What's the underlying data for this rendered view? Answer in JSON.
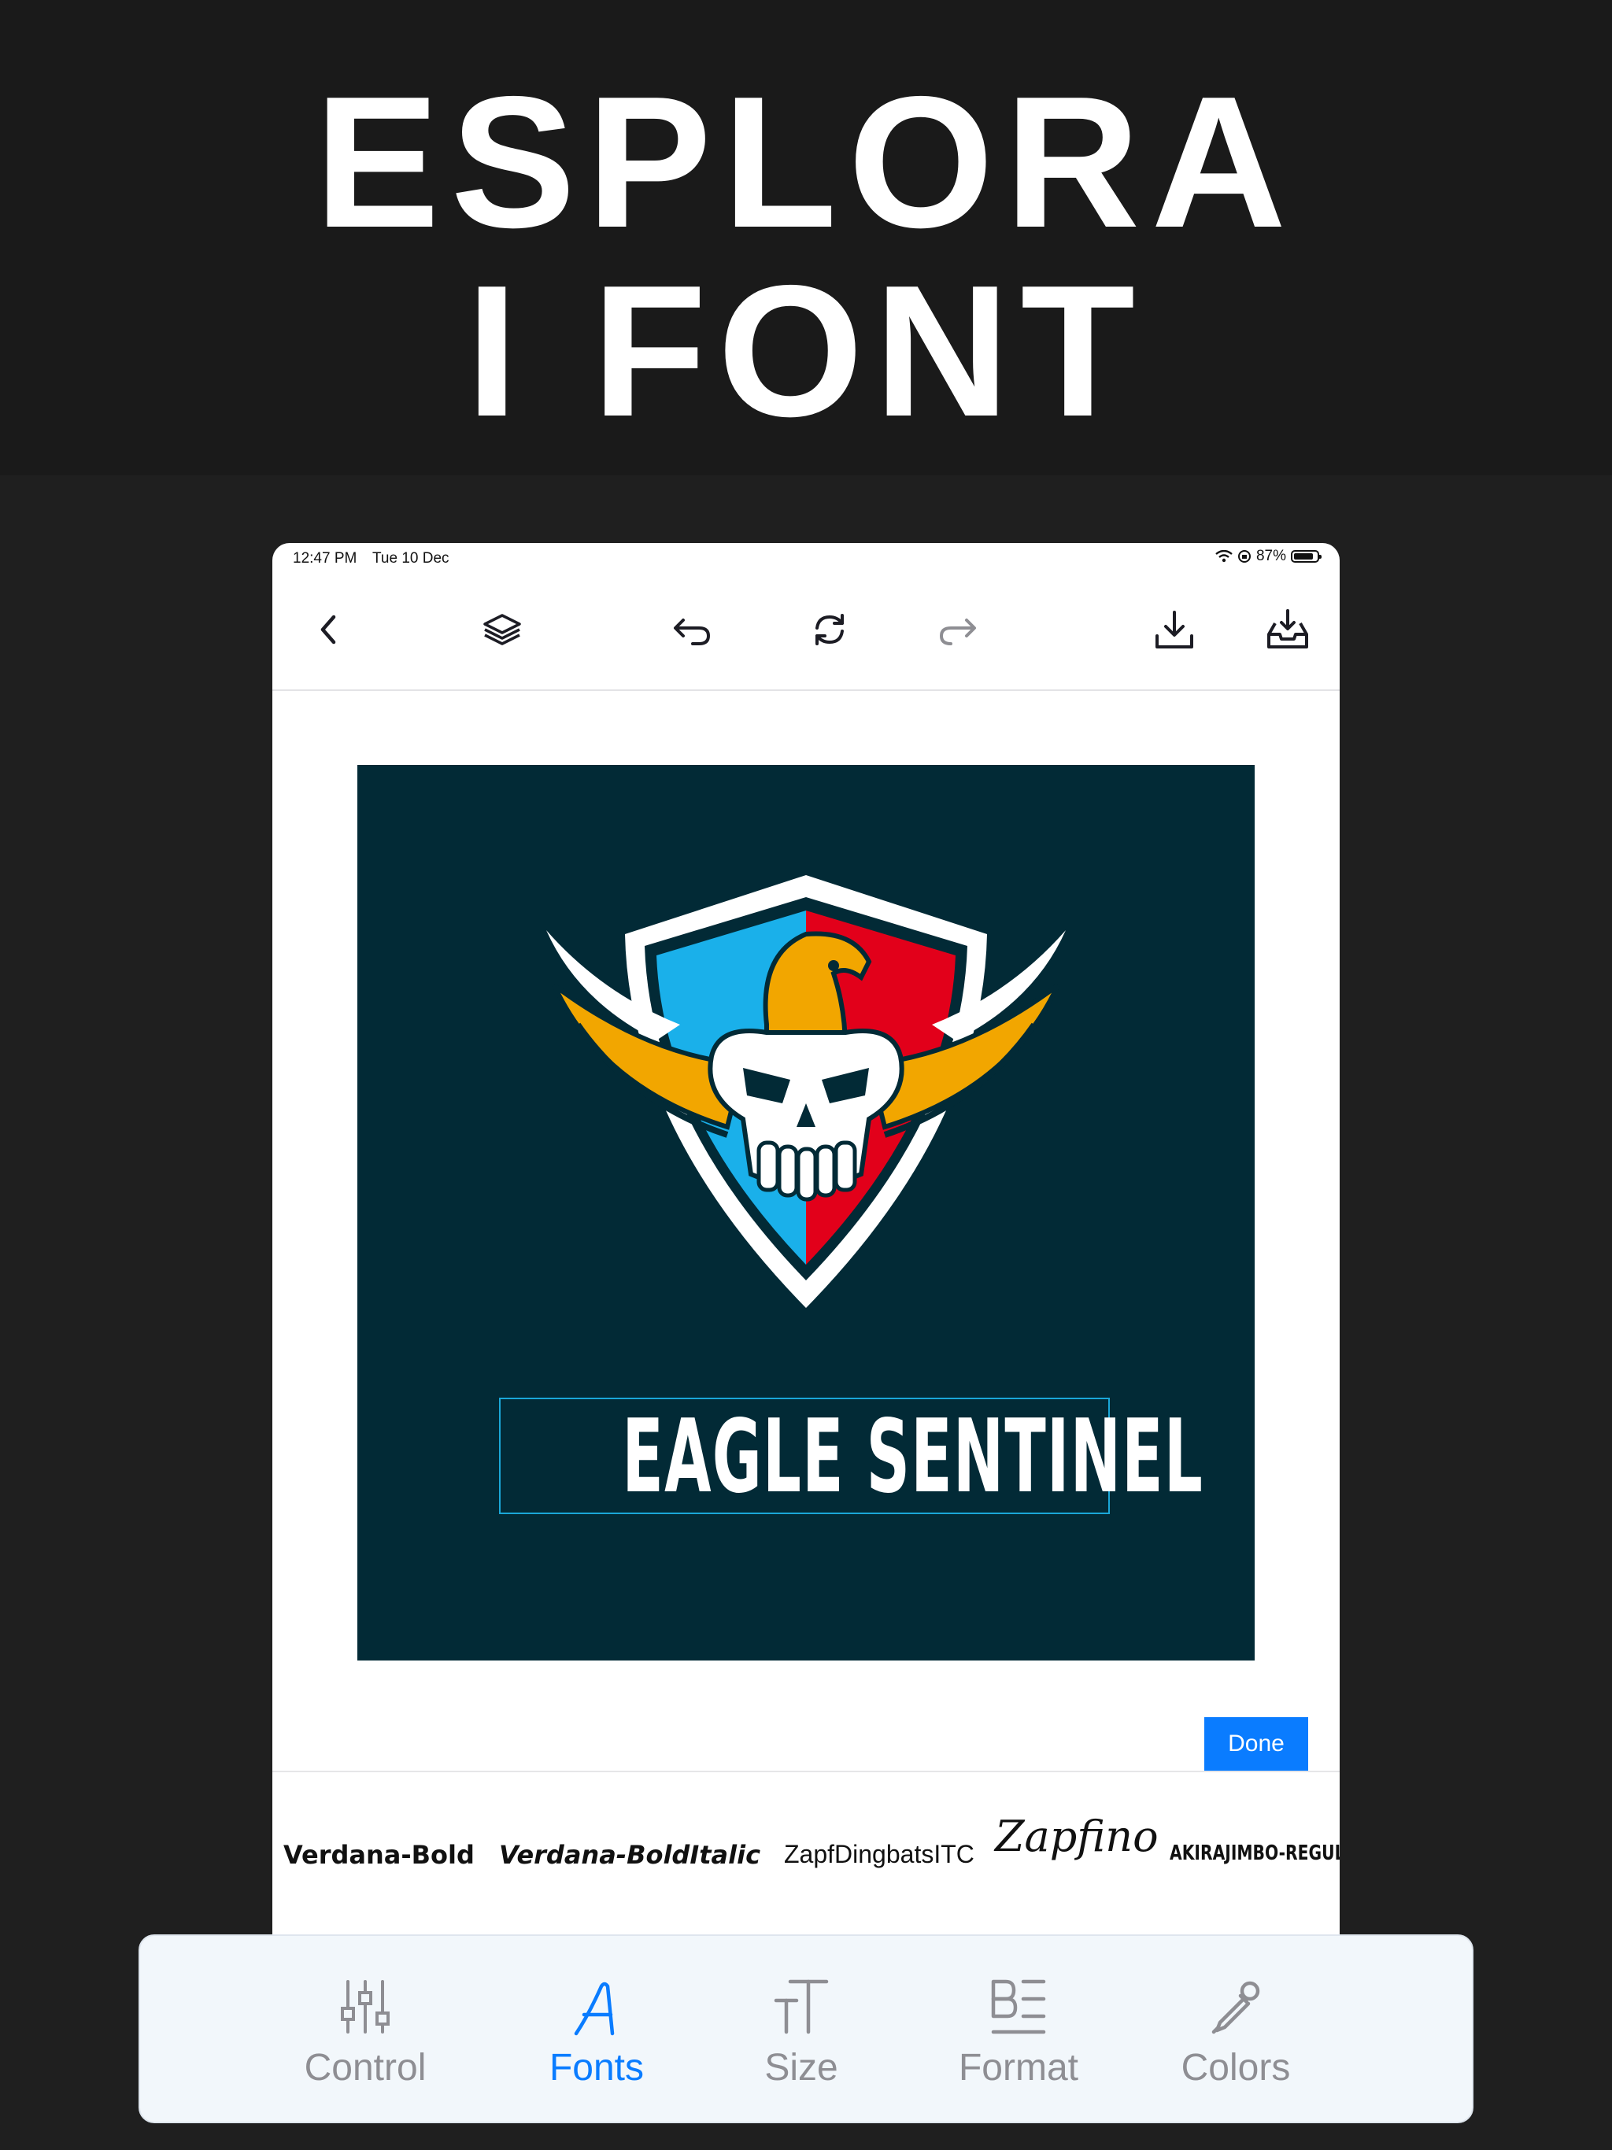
{
  "hero": {
    "line1": "ESPLORA",
    "line2": "I FONT"
  },
  "status_bar": {
    "time": "12:47 PM",
    "date": "Tue 10 Dec",
    "battery_text": "87%",
    "battery_level": 0.87
  },
  "toolbar": {
    "buttons": [
      "back-icon",
      "layers-icon",
      "undo-icon",
      "refresh-icon",
      "redo-icon",
      "download-icon",
      "save-to-tray-icon"
    ]
  },
  "canvas": {
    "background_color": "#022a36",
    "logo_text": "EAGLE SENTINEL"
  },
  "done_button": {
    "label": "Done"
  },
  "font_list": [
    {
      "name": "Verdana-Bold"
    },
    {
      "name": "Verdana-BoldItalic"
    },
    {
      "name": "ZapfDingbatsITC"
    },
    {
      "name": "Zapfino"
    },
    {
      "name": "AKIRAJIMBO-REGULAR"
    }
  ],
  "tabs": [
    {
      "label": "Control",
      "icon": "sliders-icon",
      "active": false
    },
    {
      "label": "Fonts",
      "icon": "font-icon",
      "active": true
    },
    {
      "label": "Size",
      "icon": "text-size-icon",
      "active": false
    },
    {
      "label": "Format",
      "icon": "format-icon",
      "active": false
    },
    {
      "label": "Colors",
      "icon": "eyedropper-icon",
      "active": false
    }
  ],
  "colors": {
    "accent": "#0a7cff",
    "canvas": "#022a36",
    "shield_blue": "#1ab0ea",
    "shield_red": "#e2001a",
    "eagle_gold": "#f2a600"
  }
}
